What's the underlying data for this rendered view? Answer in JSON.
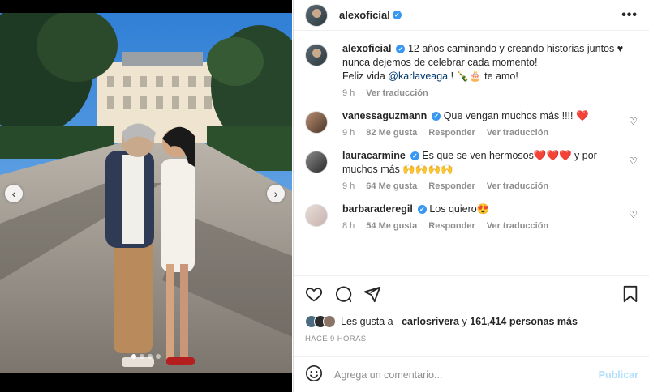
{
  "post": {
    "author": "alexoficial",
    "caption_lines": [
      "12 años caminando y creando historias juntos ♥",
      "nunca dejemos de celebrar cada momento!"
    ],
    "caption_prefix": "Feliz vida",
    "mention": "@karlaveaga",
    "caption_suffix": "! 🍾🎂 te amo!",
    "caption_time": "9 h",
    "see_translation": "Ver traducción"
  },
  "comments": [
    {
      "user": "vanessaguzmann",
      "text": "Que vengan muchos más !!!! ❤️",
      "time": "9 h",
      "likes": "82 Me gusta",
      "reply": "Responder",
      "translate": "Ver traducción"
    },
    {
      "user": "lauracarmine",
      "text": "Es que se ven hermosos❤️❤️❤️ y por muchos más 🙌🙌🙌🙌",
      "time": "9 h",
      "likes": "64 Me gusta",
      "reply": "Responder",
      "translate": "Ver traducción"
    },
    {
      "user": "barbaraderegil",
      "text": "Los quiero😍",
      "time": "8 h",
      "likes": "54 Me gusta",
      "reply": "Responder",
      "translate": "Ver traducción"
    }
  ],
  "likes": {
    "prefix": "Les gusta a",
    "first_user": "_carlosrivera",
    "connector": "y",
    "others": "161,414 personas más"
  },
  "timestamp": "HACE 9 HORAS",
  "add_comment": {
    "placeholder": "Agrega un comentario...",
    "publish": "Publicar"
  },
  "icons": {
    "more": "more-horizontal-icon",
    "like": "heart-icon",
    "comment": "comment-icon",
    "share": "share-icon",
    "save": "bookmark-icon",
    "emoji": "emoji-icon",
    "prev": "chevron-left-icon",
    "next": "chevron-right-icon"
  },
  "carousel": {
    "dot_count": 4,
    "active_index": 0
  }
}
